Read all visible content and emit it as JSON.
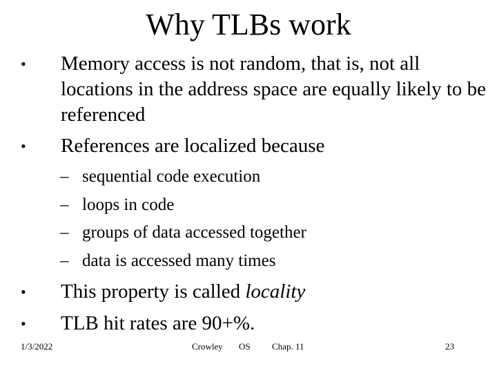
{
  "slide": {
    "title": "Why TLBs work",
    "bullets": [
      {
        "marker": "•",
        "text": "Memory access is not random, that is, not all locations in the address space are equally likely to be referenced"
      },
      {
        "marker": "•",
        "text": "References are localized because"
      }
    ],
    "sub_bullets": [
      {
        "marker": "–",
        "text": "sequential code execution"
      },
      {
        "marker": "–",
        "text": "loops in code"
      },
      {
        "marker": "–",
        "text": "groups of data accessed together"
      },
      {
        "marker": "–",
        "text": "data is accessed many times"
      }
    ],
    "bullets_after": [
      {
        "marker": "•",
        "text": "This property is called ",
        "emphasis": "locality"
      },
      {
        "marker": "•",
        "text": "TLB hit rates are 90+%."
      }
    ]
  },
  "footer": {
    "date": "1/3/2022",
    "author": "Crowley",
    "course": "OS",
    "chapter": "Chap. 11",
    "page_number": "23"
  }
}
